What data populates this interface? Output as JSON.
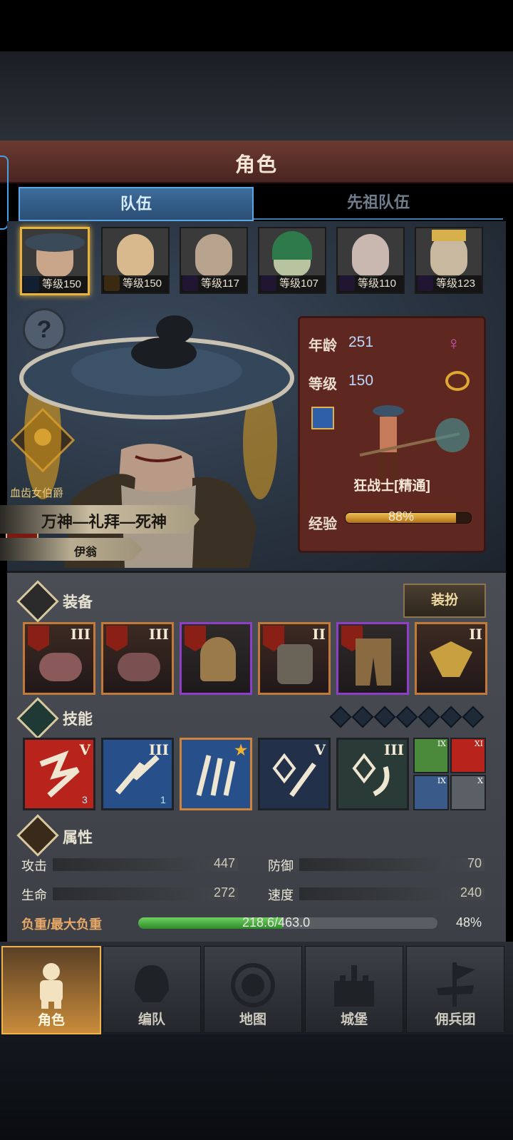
{
  "screen": {
    "title": "角色"
  },
  "tabs": {
    "team": "队伍",
    "ancestors": "先祖队伍"
  },
  "party": [
    {
      "level_text": "等级150",
      "class_icon": "sword-icon",
      "selected": true
    },
    {
      "level_text": "等级150",
      "class_icon": "shield-icon",
      "selected": false
    },
    {
      "level_text": "等级117",
      "class_icon": "staff-icon",
      "selected": false
    },
    {
      "level_text": "等级107",
      "class_icon": "staff-icon",
      "selected": false
    },
    {
      "level_text": "等级110",
      "class_icon": "staff-icon",
      "selected": false
    },
    {
      "level_text": "等级123",
      "class_icon": "staff-icon",
      "selected": false
    }
  ],
  "hero": {
    "title_badge": "血齿女伯爵",
    "name": "万神—礼拜—死神",
    "subname": "伊翁"
  },
  "info": {
    "age_label": "年龄",
    "age_value": "251",
    "level_label": "等级",
    "level_value": "150",
    "class_name": "狂战士[精通]",
    "exp_label": "经验",
    "exp_value": "88%",
    "exp_fraction": 0.88,
    "gender_icon": "female-icon",
    "ring_icon": "ring-icon"
  },
  "equipment": {
    "title": "装备",
    "dress_button": "装扮",
    "items": [
      {
        "rank": "III",
        "rarity": "orange"
      },
      {
        "rank": "III",
        "rarity": "orange"
      },
      {
        "rank": "",
        "rarity": "purple"
      },
      {
        "rank": "II",
        "rarity": "orange"
      },
      {
        "rank": "",
        "rarity": "purple"
      },
      {
        "rank": "II",
        "rarity": "orange"
      }
    ]
  },
  "skills": {
    "title": "技能",
    "slots": 8,
    "items": [
      {
        "rank": "V",
        "badge": "3",
        "color": "#b8231c"
      },
      {
        "rank": "III",
        "badge": "1",
        "color": "#27508a"
      },
      {
        "rank": "★",
        "badge": "",
        "color": "#27508a"
      },
      {
        "rank": "V",
        "badge": "",
        "color": "#22304a"
      },
      {
        "rank": "III",
        "badge": "",
        "color": "#2a3a36"
      }
    ],
    "minis": [
      {
        "rank": "IX",
        "color": "#4a8a3a"
      },
      {
        "rank": "XI",
        "color": "#b8231c"
      },
      {
        "rank": "IX",
        "color": "#3a5a8a"
      },
      {
        "rank": "X",
        "color": "#5a6066"
      }
    ]
  },
  "attributes": {
    "title": "属性",
    "attack_label": "攻击",
    "attack": "447",
    "defense_label": "防御",
    "defense": "70",
    "hp_label": "生命",
    "hp": "272",
    "speed_label": "速度",
    "speed": "240",
    "load_label": "负重/最大负重",
    "load_value": "218.6/463.0",
    "load_pct": "48%",
    "load_fraction": 0.48
  },
  "nav": {
    "character": "角色",
    "formation": "编队",
    "map": "地图",
    "castle": "城堡",
    "mercenary": "佣兵团"
  }
}
